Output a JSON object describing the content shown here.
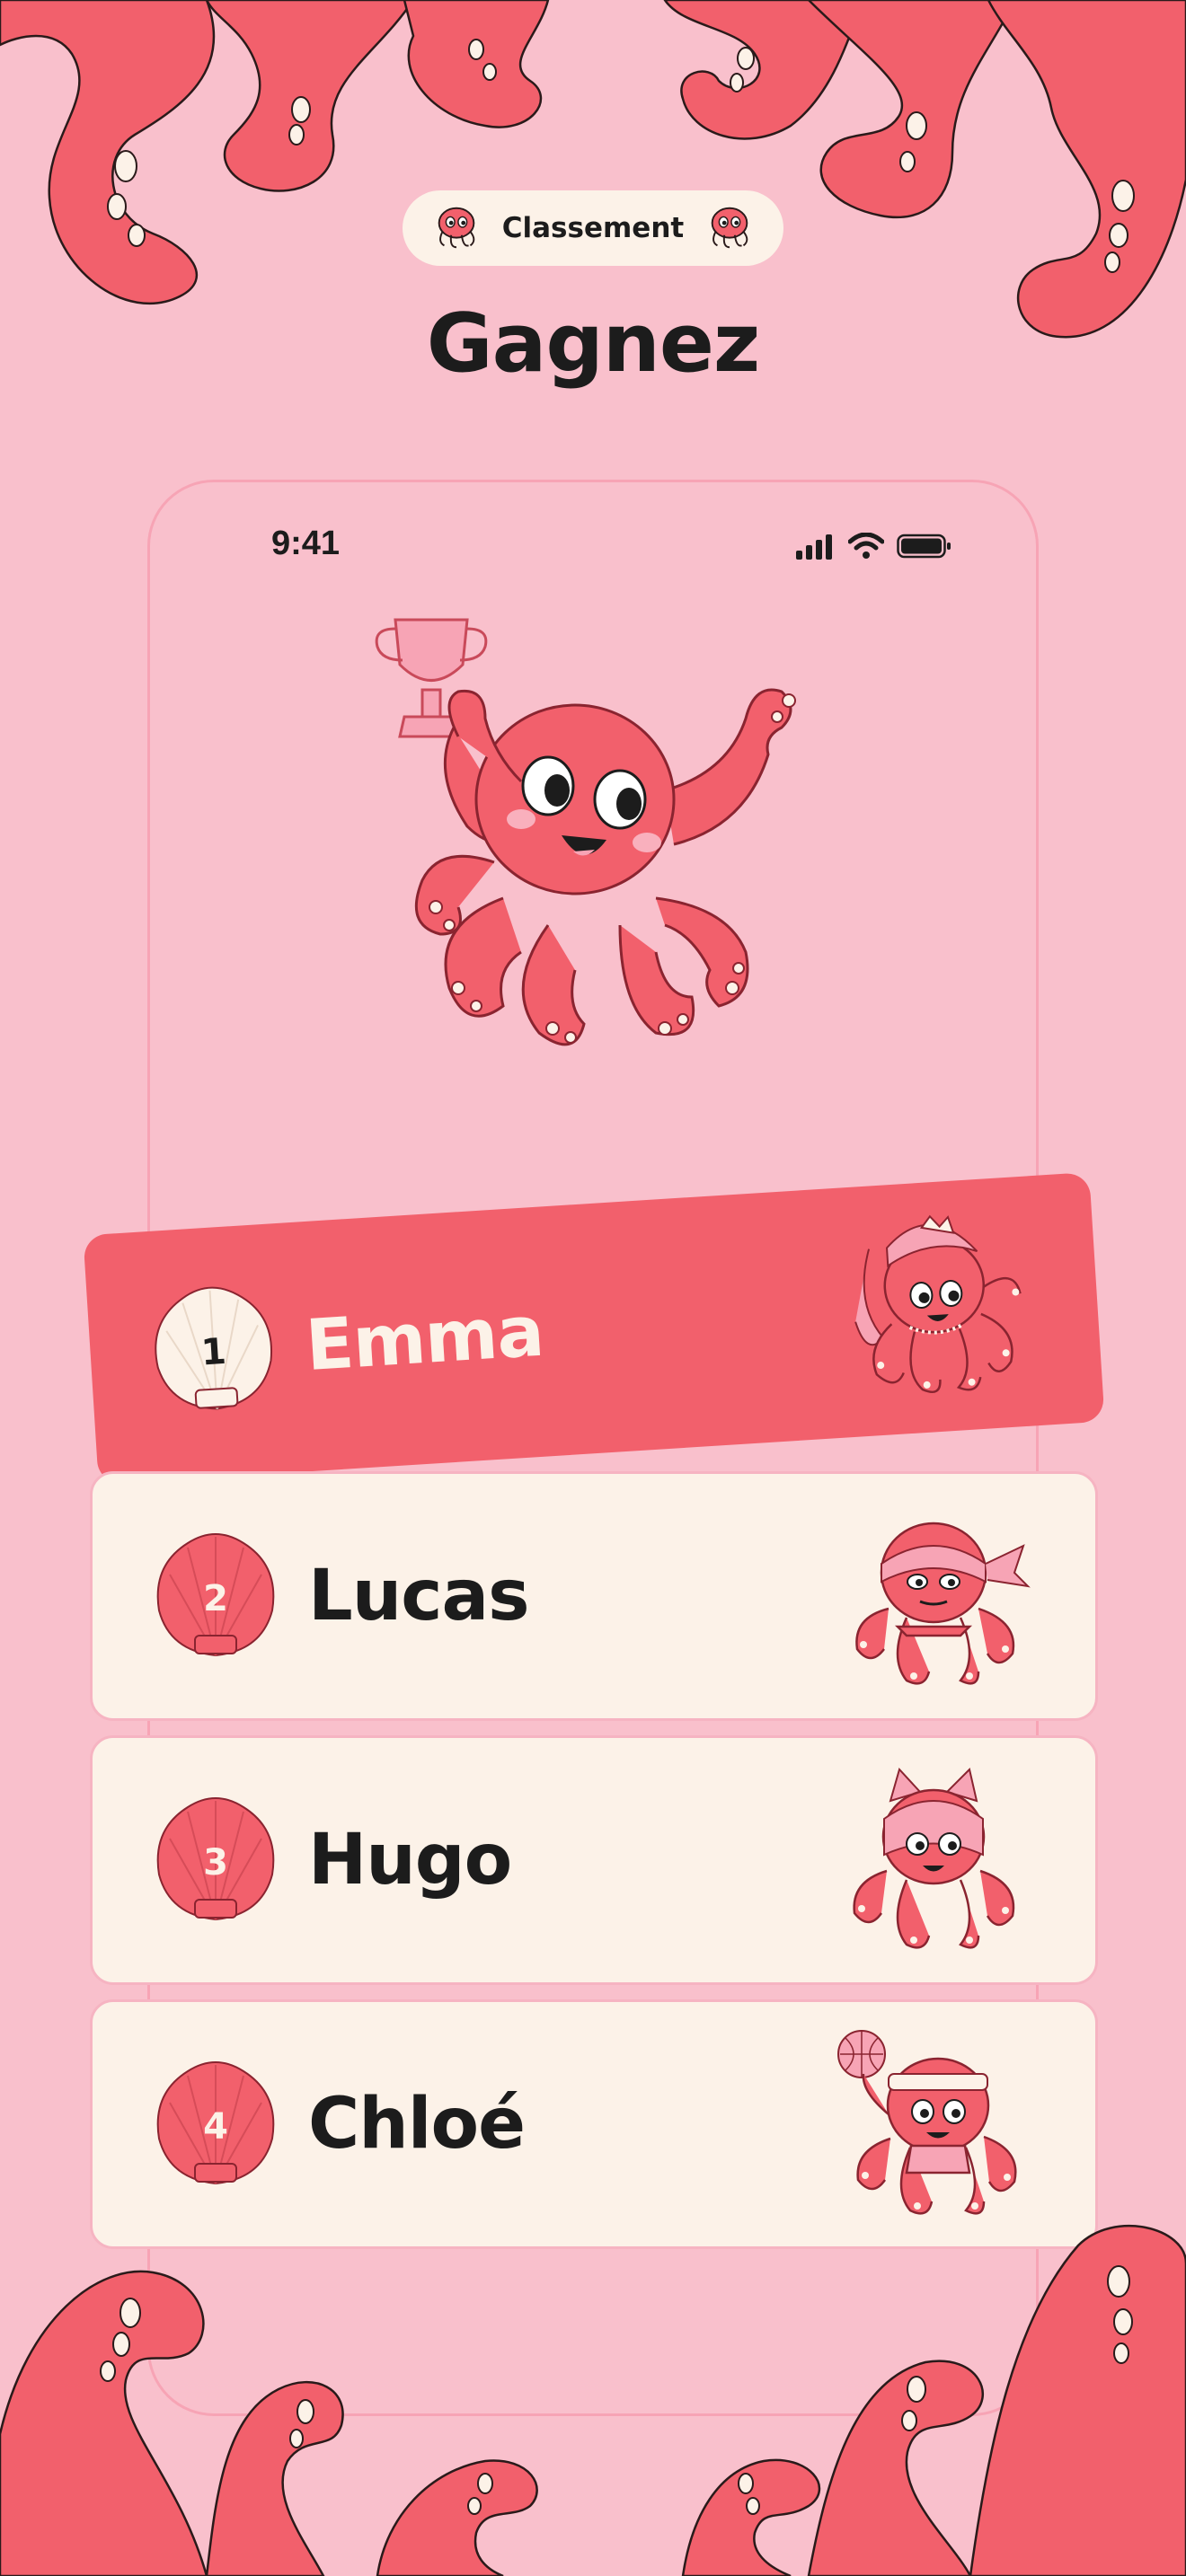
{
  "header": {
    "badge_label": "Classement",
    "title": "Gagnez"
  },
  "status_bar": {
    "time": "9:41"
  },
  "leaderboard": [
    {
      "rank": "1",
      "name": "Emma"
    },
    {
      "rank": "2",
      "name": "Lucas"
    },
    {
      "rank": "3",
      "name": "Hugo"
    },
    {
      "rank": "4",
      "name": "Chloé"
    }
  ],
  "colors": {
    "background": "#f9c0cc",
    "accent": "#f2606c",
    "card": "#fcf2e8",
    "text": "#1c1c1c"
  },
  "icons": [
    "octopus-icon",
    "trophy-icon",
    "shell-icon",
    "signal-icon",
    "wifi-icon",
    "battery-icon"
  ]
}
